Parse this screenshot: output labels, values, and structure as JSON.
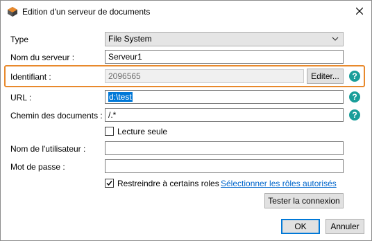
{
  "window": {
    "title": "Edition d'un serveur de documents"
  },
  "form": {
    "type_label": "Type",
    "type_value": "File System",
    "server_name_label": "Nom du serveur :",
    "server_name_value": "Serveur1",
    "identifier_label": "Identifiant :",
    "identifier_value": "2096565",
    "edit_button": "Editer...",
    "url_label": "URL :",
    "url_value": "d:\\test",
    "doc_path_label": "Chemin des documents :",
    "doc_path_value": "/.*",
    "readonly_label": "Lecture seule",
    "readonly_checked": false,
    "username_label": "Nom de l'utilisateur :",
    "username_value": "",
    "password_label": "Mot de passe :",
    "password_value": "",
    "restrict_roles_label": "Restreindre à certains roles",
    "restrict_roles_checked": true,
    "select_roles_link": "Sélectionner les rôles autorisés",
    "test_connection_button": "Tester la connexion"
  },
  "footer": {
    "ok_button": "OK",
    "cancel_button": "Annuler"
  },
  "help_icon_glyph": "?",
  "colors": {
    "highlight": "#e8892c",
    "help_icon": "#1a9e9a",
    "accent": "#0078d7",
    "link": "#0066cc"
  }
}
